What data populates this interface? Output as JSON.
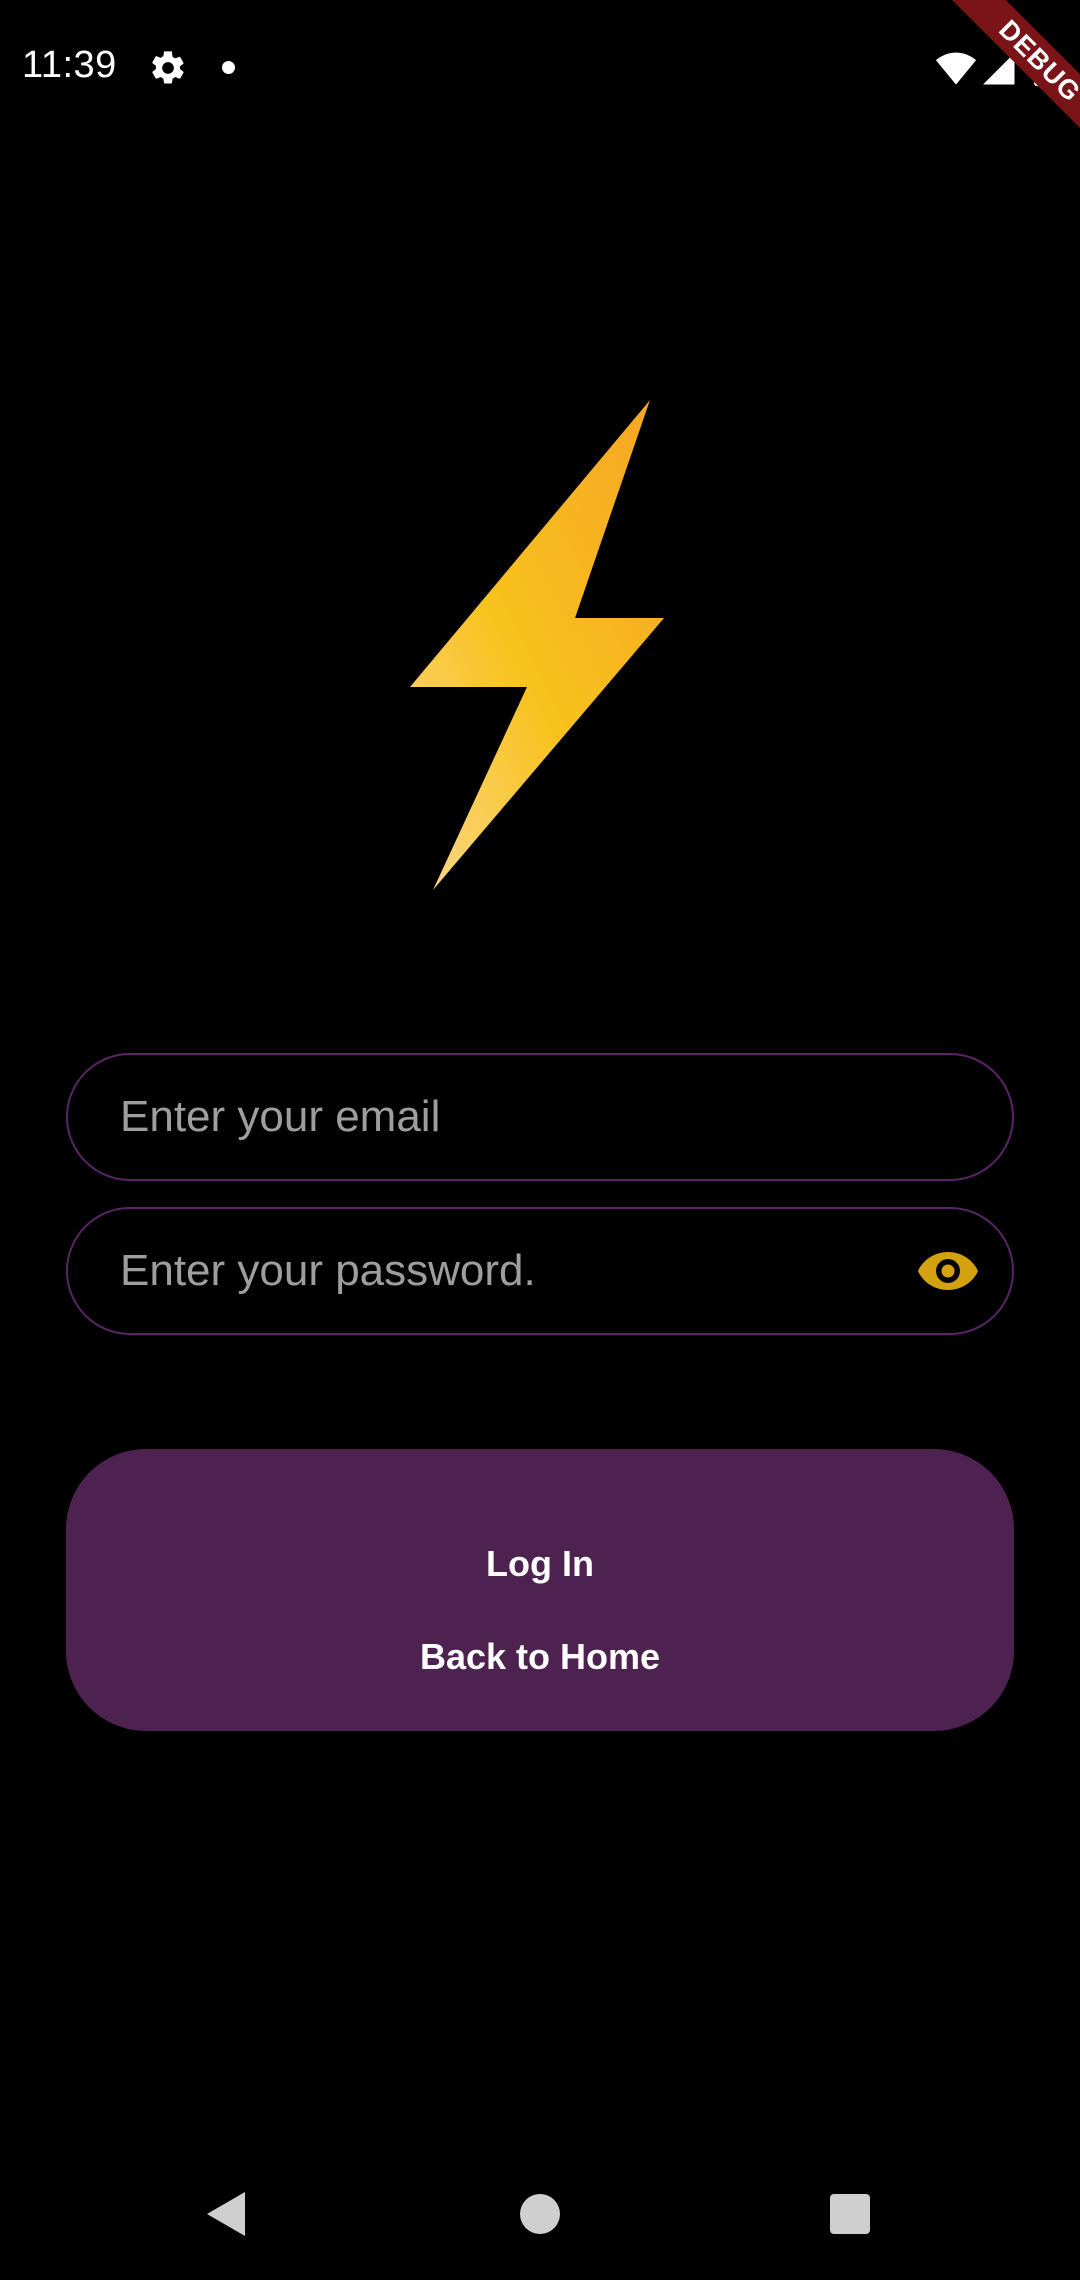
{
  "status_bar": {
    "time": "11:39",
    "icons": [
      "gear-icon",
      "notification-dot-icon",
      "wifi-icon",
      "signal-icon",
      "battery-icon"
    ]
  },
  "debug_banner": {
    "label": "DEBUG",
    "color": "#7a1418"
  },
  "logo": {
    "icon": "lightning-bolt-icon",
    "gradient_colors": [
      "#f5a524",
      "#f8c21c",
      "#fbd88a"
    ]
  },
  "login_form": {
    "email_placeholder": "Enter your email",
    "password_placeholder": "Enter your password.",
    "password_toggle_icon": "eye-icon",
    "field_border_color": "#5a2466",
    "icon_color": "#d4a20f"
  },
  "actions": {
    "login_label": "Log In",
    "home_label": "Back to Home",
    "panel_color": "#4d2251"
  },
  "nav_bar": {
    "icons": [
      "back-triangle-icon",
      "home-circle-icon",
      "recents-square-icon"
    ]
  }
}
